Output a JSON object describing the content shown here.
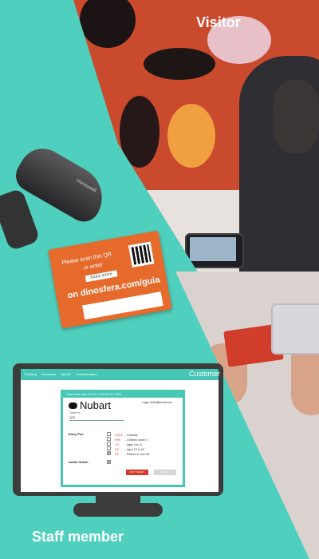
{
  "captions": {
    "visitor": "Visitor",
    "staff": "Staff member"
  },
  "flyer": {
    "line1": "Please scan this QR",
    "line2": "or enter",
    "code": "XXXX XXXX",
    "line3": "on dinosfera.com/guia"
  },
  "scanner_brand": "Honeywell",
  "monitor": {
    "nav": [
      "Ticketing",
      "Download",
      "Upload",
      "Administration"
    ],
    "customer_label": "Customer",
    "ticket_bar": "Ticket Paid: Mon Feb 02 11:34:43 GST 2020",
    "brand": "Nubart",
    "login": "Login: ticket@email.com",
    "field_label": "Ticket nr.",
    "field_value": "103",
    "entry_fee_label": "Entry Fee:",
    "audio_guide_label": "Audio Guide:",
    "fees": [
      {
        "price": "3,50 €",
        "desc": "- Ordinary"
      },
      {
        "price": "Free",
        "desc": "- Children under 4"
      },
      {
        "price": "1 €",
        "desc": "- Ages 4 to 11"
      },
      {
        "price": "3 €",
        "desc": "- Ages 12 to 18"
      },
      {
        "price": "3 €",
        "desc": "- Retired or over 65"
      }
    ],
    "buy_button": "BUY TICKET",
    "back_button": "BACK"
  },
  "colors": {
    "teal": "#4fcfbd",
    "nav_teal": "#46c7b5",
    "orange": "#e66a2c",
    "red_button": "#d23a2a",
    "monitor": "#3d3c3c"
  }
}
